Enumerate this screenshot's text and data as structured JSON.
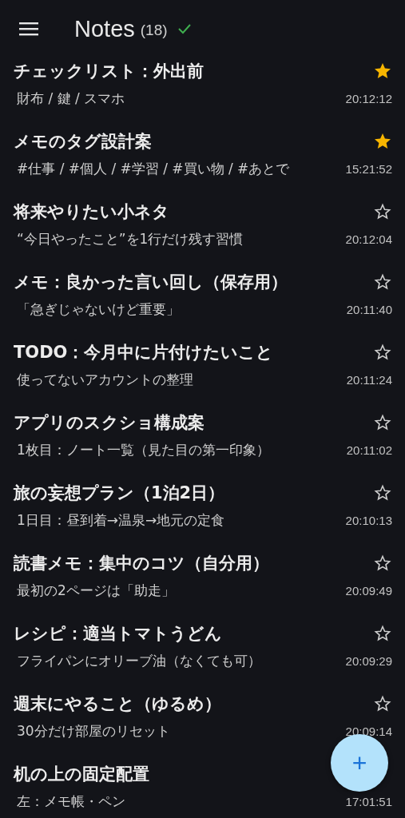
{
  "header": {
    "title": "Notes",
    "count": "(18)",
    "synced": true
  },
  "notes": [
    {
      "title": "チェックリスト：外出前",
      "preview": "財布 / 鍵 / スマホ",
      "time": "20:12:12",
      "starred": true
    },
    {
      "title": "メモのタグ設計案",
      "preview": "#仕事 / #個人 / #学習 / #買い物 / #あとで",
      "time": "15:21:52",
      "starred": true
    },
    {
      "title": "将来やりたい小ネタ",
      "preview": "“今日やったこと”を1行だけ残す習慣",
      "time": "20:12:04",
      "starred": false
    },
    {
      "title": "メモ：良かった言い回し（保存用）",
      "preview": "「急ぎじゃないけど重要」",
      "time": "20:11:40",
      "starred": false
    },
    {
      "title": "TODO：今月中に片付けたいこと",
      "preview": "使ってないアカウントの整理",
      "time": "20:11:24",
      "starred": false
    },
    {
      "title": "アプリのスクショ構成案",
      "preview": "1枚目：ノート一覧（見た目の第一印象）",
      "time": "20:11:02",
      "starred": false
    },
    {
      "title": "旅の妄想プラン（1泊2日）",
      "preview": "1日目：昼到着→温泉→地元の定食",
      "time": "20:10:13",
      "starred": false
    },
    {
      "title": "読書メモ：集中のコツ（自分用）",
      "preview": "最初の2ページは「助走」",
      "time": "20:09:49",
      "starred": false
    },
    {
      "title": "レシピ：適当トマトうどん",
      "preview": "フライパンにオリーブ油（なくても可）",
      "time": "20:09:29",
      "starred": false
    },
    {
      "title": "週末にやること（ゆるめ）",
      "preview": "30分だけ部屋のリセット",
      "time": "20:09:14",
      "starred": false
    },
    {
      "title": "机の上の固定配置",
      "preview": "左：メモ帳・ペン",
      "time": "17:01:51"
    }
  ],
  "fab": {
    "label": "+"
  }
}
